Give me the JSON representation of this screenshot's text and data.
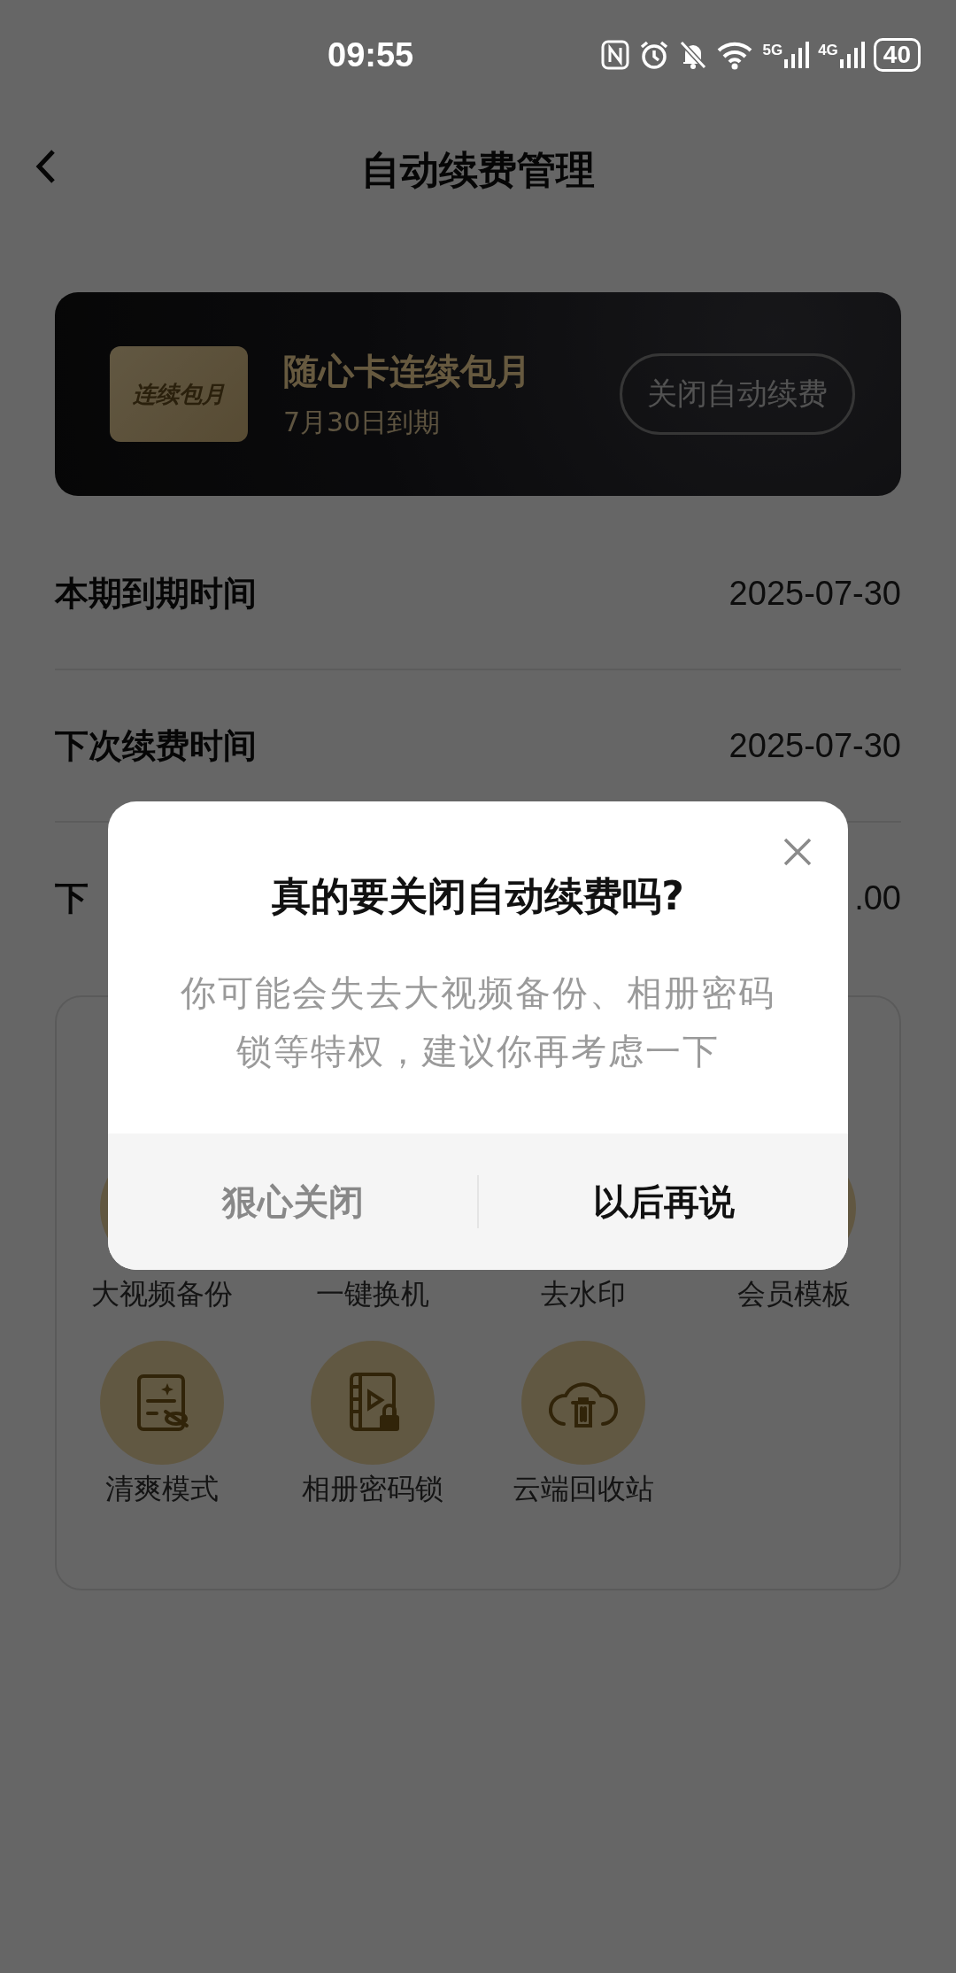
{
  "status_bar": {
    "time": "09:55",
    "signal_5g": "5G",
    "signal_4g": "4G",
    "battery": "40"
  },
  "header": {
    "title": "自动续费管理"
  },
  "plan_card": {
    "badge": "连续包月",
    "title": "随心卡连续包月",
    "subtitle": "7月30日到期",
    "button": "关闭自动续费"
  },
  "rows": [
    {
      "label": "本期到期时间",
      "value": "2025-07-30"
    },
    {
      "label": "下次续费时间",
      "value": "2025-07-30"
    },
    {
      "label": "下",
      "value": ".00"
    }
  ],
  "benefits": [
    {
      "label": "大视频备份",
      "kind": "covered"
    },
    {
      "label": "一键换机",
      "kind": "hidden"
    },
    {
      "label": "去水印",
      "kind": "hidden"
    },
    {
      "label": "会员模板",
      "kind": "covered"
    },
    {
      "label": "清爽模式",
      "kind": "clean"
    },
    {
      "label": "相册密码锁",
      "kind": "album"
    },
    {
      "label": "云端回收站",
      "kind": "trash"
    }
  ],
  "dialog": {
    "title": "真的要关闭自动续费吗?",
    "message": "你可能会失去大视频备份、相册密码锁等特权，建议你再考虑一下",
    "buttons": [
      {
        "label": "狠心关闭",
        "kind": "secondary"
      },
      {
        "label": "以后再说",
        "kind": "primary"
      }
    ]
  }
}
